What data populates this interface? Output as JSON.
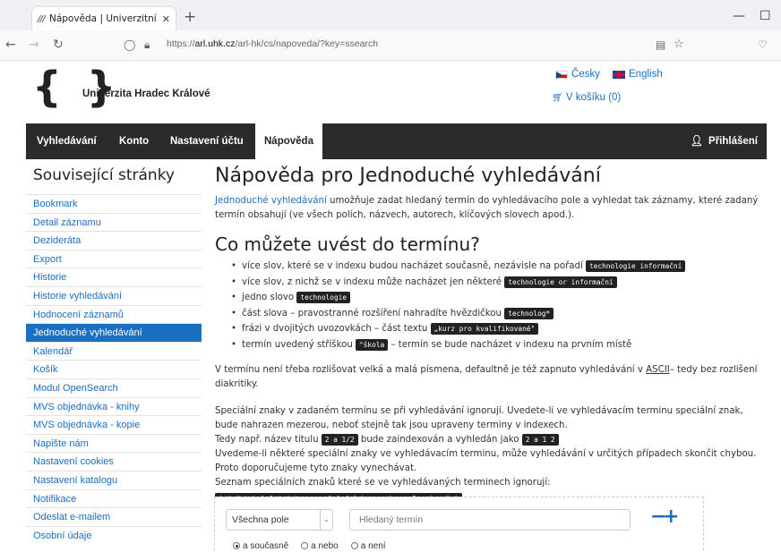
{
  "browser": {
    "tab_title": "Nápověda | Univerzitní knihovn",
    "url_prefix": "https://",
    "url_host": "arl.uhk.cz",
    "url_path": "/arl-hk/cs/napoveda/?key=ssearch"
  },
  "header": {
    "logo_text": "Univerzita Hradec Králové",
    "lang_cs": "Česky",
    "lang_en": "English",
    "cart": "V košíku (0)"
  },
  "menu": {
    "items": [
      "Vyhledávání",
      "Konto",
      "Nastavení účtu",
      "Nápověda"
    ],
    "login": "Přihlášení"
  },
  "sidebar": {
    "title": "Související stránky",
    "items": [
      "Bookmark",
      "Detail záznamu",
      "Dezideráta",
      "Export",
      "Historie",
      "Historie vyhledávání",
      "Hodnocení záznamů",
      "Jednoduché vyhledávání",
      "Kalendář",
      "Košík",
      "Modul OpenSearch",
      "MVS objednávka - knihy",
      "MVS objednávka - kopie",
      "Napište nám",
      "Nastavení cookies",
      "Nastavení katalogu",
      "Notifikace",
      "Odeslat e-mailem",
      "Osobní údaje"
    ],
    "active_index": 7
  },
  "content": {
    "title": "Nápověda pro Jednoduché vyhledávání",
    "intro_link": "Jednoduché vyhledávání",
    "intro_text": " umožňuje zadat hledaný termín do vyhledávacího pole a vyhledat tak záznamy, které zadaný termín obsahují (ve všech polích, názvech, autorech, klíčových slovech apod.).",
    "subtitle": "Co můžete uvést do termínu?",
    "bullets": [
      {
        "text": "více slov, které se v indexu budou nacházet současně, nezávisle na pořadí ",
        "code": "technologie informační",
        "after": ""
      },
      {
        "text": "více slov, z nichž se v indexu může nacházet jen některé ",
        "code": "technologie or informační",
        "after": ""
      },
      {
        "text": "jedno slovo ",
        "code": "technologie",
        "after": ""
      },
      {
        "text": "část slova – pravostranné rozšíření nahradíte hvězdičkou ",
        "code": "technolog*",
        "after": ""
      },
      {
        "text": "frázi v dvojitých uvozovkách – část textu ",
        "code": "„kurz pro kvalifikované\"",
        "after": ""
      },
      {
        "text": "termín uvedený stříškou ",
        "code": "^škola",
        "after": " – termín se bude nacházet v indexu na prvním místě"
      }
    ],
    "case_text_1": "V termínu není třeba rozlišovat velká a malá písmena, defaultně je též zapnuto vyhledávání v ",
    "case_abbr": "ASCII",
    "case_text_2": "– tedy bez rozlišení diakritiky.",
    "special_1": "Speciální znaky v zadaném termínu se při vyhledávání ignorují. Uvedete-li ve vyhledávacím terminu speciální znak, bude nahrazen mezerou, neboť stejně tak jsou upraveny terminy v indexech.",
    "special_2a": "Tedy např. název titulu ",
    "special_2_code1": "2 a 1/2",
    "special_2b": " bude zaindexován a vyhledán jako ",
    "special_2_code2": "2 a 1 2",
    "special_3": "Uvedeme-li některé speciální znaky ve vyhledávacím terminu, může vyhledávání v určitých případech skončit chybou. Proto doporučujeme tyto znaky vynechávat.",
    "special_4": "Seznam speciálních znaků které se ve vyhledávaných terminech ignorují:",
    "special_chars": "! @ # $ % ^ & * ( ) - + = [ ] { } \\ , . / < > ? ; ' : \" |"
  },
  "search": {
    "field_select": "Všechna pole",
    "placeholder": "Hledaný termín",
    "minus": "−",
    "plus": "+",
    "radios": [
      "a současně",
      "a nebo",
      "a není"
    ]
  },
  "colors": {
    "link": "#1a6fc0",
    "menu_bg": "#2b2b2b",
    "active": "#1a6fc0"
  }
}
